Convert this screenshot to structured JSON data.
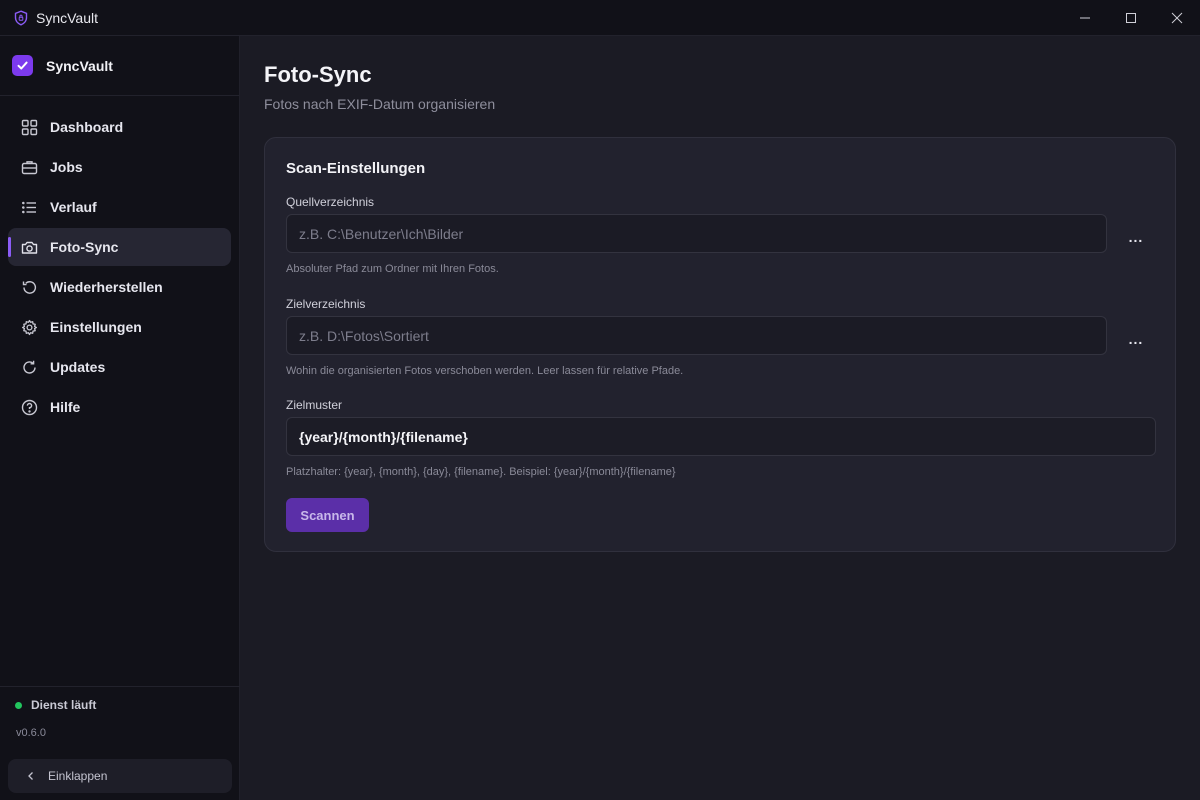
{
  "window": {
    "title": "SyncVault"
  },
  "sidebar": {
    "brand": "SyncVault",
    "items": [
      {
        "label": "Dashboard",
        "icon": "grid-icon",
        "active": false
      },
      {
        "label": "Jobs",
        "icon": "briefcase-icon",
        "active": false
      },
      {
        "label": "Verlauf",
        "icon": "list-icon",
        "active": false
      },
      {
        "label": "Foto-Sync",
        "icon": "camera-icon",
        "active": true
      },
      {
        "label": "Wiederherstellen",
        "icon": "restore-icon",
        "active": false
      },
      {
        "label": "Einstellungen",
        "icon": "gear-icon",
        "active": false
      },
      {
        "label": "Updates",
        "icon": "refresh-icon",
        "active": false
      },
      {
        "label": "Hilfe",
        "icon": "help-icon",
        "active": false
      }
    ],
    "status": "Dienst läuft",
    "version": "v0.6.0",
    "collapse_label": "Einklappen"
  },
  "page": {
    "title": "Foto-Sync",
    "subtitle": "Fotos nach EXIF-Datum organisieren"
  },
  "scan": {
    "title": "Scan-Einstellungen",
    "source": {
      "label": "Quellverzeichnis",
      "placeholder": "z.B. C:\\Benutzer\\Ich\\Bilder",
      "value": "",
      "hint": "Absoluter Pfad zum Ordner mit Ihren Fotos.",
      "browse": "..."
    },
    "target": {
      "label": "Zielverzeichnis",
      "placeholder": "z.B. D:\\Fotos\\Sortiert",
      "value": "",
      "hint": "Wohin die organisierten Fotos verschoben werden. Leer lassen für relative Pfade.",
      "browse": "..."
    },
    "pattern": {
      "label": "Zielmuster",
      "value": "{year}/{month}/{filename}",
      "hint": "Platzhalter: {year}, {month}, {day}, {filename}. Beispiel: {year}/{month}/{filename}"
    },
    "button": "Scannen"
  },
  "colors": {
    "accent": "#7c3aed",
    "status_ok": "#22c55e"
  }
}
